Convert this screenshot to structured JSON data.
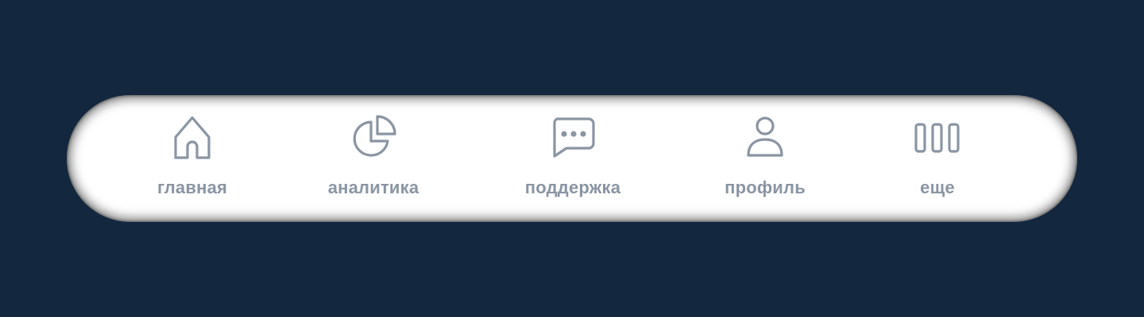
{
  "colors": {
    "background": "#13273f",
    "bar": "#ffffff",
    "icon_and_label": "#8a95a3"
  },
  "nav": {
    "items": [
      {
        "id": "home",
        "label": "главная",
        "icon": "home-icon"
      },
      {
        "id": "analytics",
        "label": "аналитика",
        "icon": "pie-chart-icon"
      },
      {
        "id": "support",
        "label": "поддержка",
        "icon": "chat-bubble-icon"
      },
      {
        "id": "profile",
        "label": "профиль",
        "icon": "user-icon"
      },
      {
        "id": "more",
        "label": "еще",
        "icon": "columns-icon"
      }
    ]
  }
}
